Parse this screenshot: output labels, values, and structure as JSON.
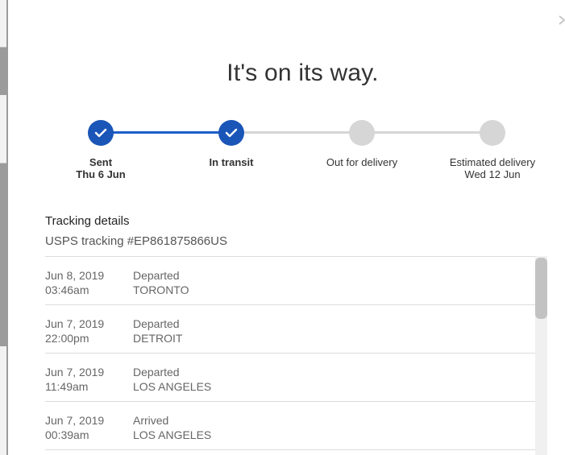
{
  "modal": {
    "title": "It's on its way.",
    "close_icon": "chevron-right-icon"
  },
  "tracker": {
    "steps": [
      {
        "label": "Sent",
        "sub": "Thu 6 Jun",
        "status": "done"
      },
      {
        "label": "In transit",
        "sub": "",
        "status": "done"
      },
      {
        "label": "Out for delivery",
        "sub": "",
        "status": "pending"
      },
      {
        "label": "Estimated delivery",
        "sub": "Wed 12 Jun",
        "status": "pending"
      }
    ],
    "colors": {
      "done": "#1a55b8",
      "pending": "#d6d6d6"
    }
  },
  "tracking": {
    "heading": "Tracking details",
    "number_line": "USPS tracking #EP861875866US",
    "events": [
      {
        "date": "Jun 8, 2019",
        "time": "03:46am",
        "status": "Departed",
        "location": "TORONTO"
      },
      {
        "date": "Jun 7, 2019",
        "time": "22:00pm",
        "status": "Departed",
        "location": "DETROIT"
      },
      {
        "date": "Jun 7, 2019",
        "time": "11:49am",
        "status": "Departed",
        "location": "LOS ANGELES"
      },
      {
        "date": "Jun 7, 2019",
        "time": "00:39am",
        "status": "Arrived",
        "location": "LOS ANGELES"
      }
    ]
  }
}
